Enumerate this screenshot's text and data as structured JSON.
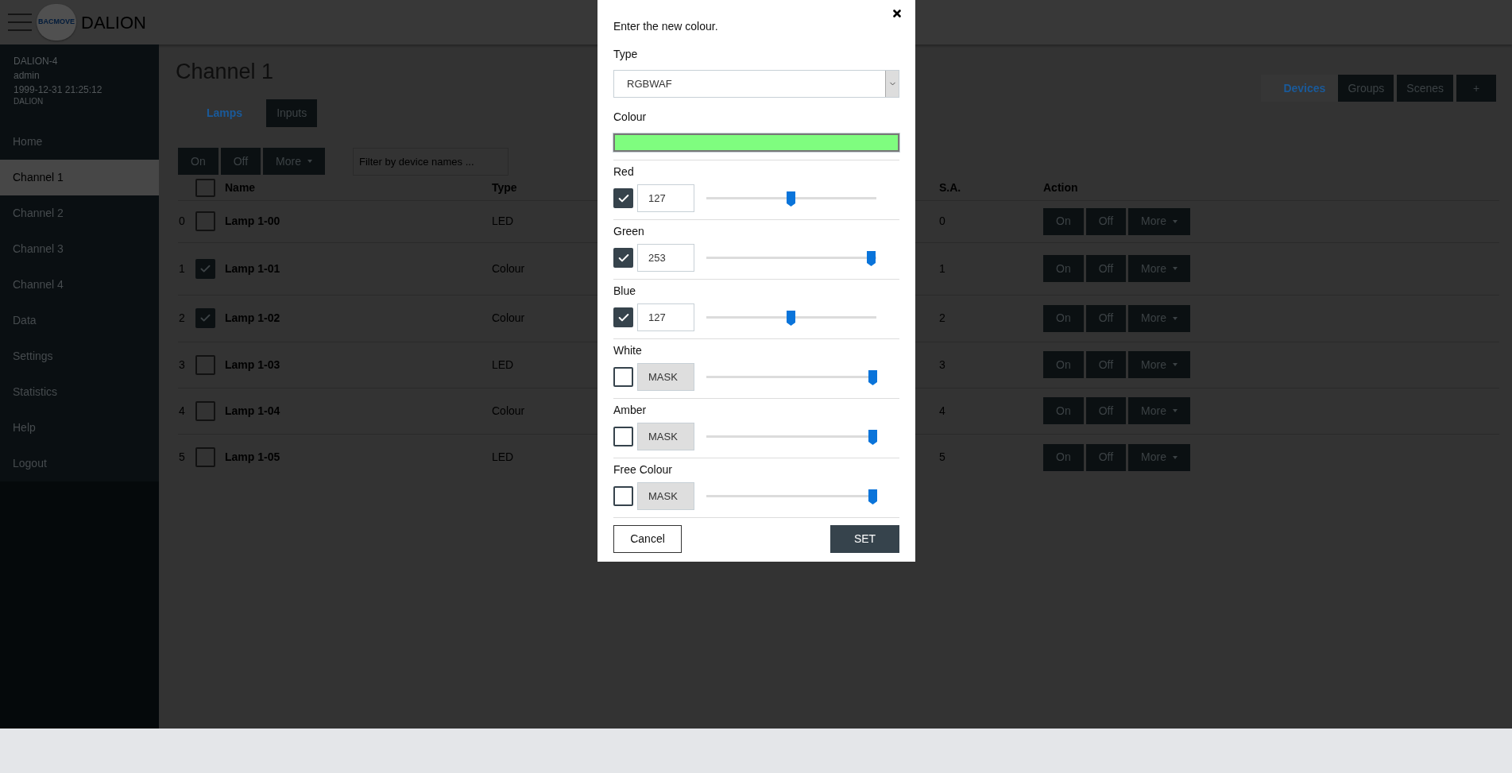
{
  "header": {
    "logo_text": "BACMOVE",
    "title": "DALION"
  },
  "sidebar": {
    "info": [
      "DALION-4",
      "admin",
      "1999-12-31 21:25:12",
      "DALION"
    ],
    "items": [
      {
        "label": "Home",
        "selected": false
      },
      {
        "label": "Channel 1",
        "selected": true
      },
      {
        "label": "Channel 2",
        "selected": false
      },
      {
        "label": "Channel 3",
        "selected": false
      },
      {
        "label": "Channel 4",
        "selected": false
      },
      {
        "label": "Data",
        "selected": false
      },
      {
        "label": "Settings",
        "selected": false
      },
      {
        "label": "Statistics",
        "selected": false
      },
      {
        "label": "Help",
        "selected": false
      },
      {
        "label": "Logout",
        "selected": false
      }
    ]
  },
  "page_title": "Channel 1",
  "view_tabs": [
    {
      "label": "Lamps",
      "selected": true
    },
    {
      "label": "Inputs",
      "selected": false
    }
  ],
  "top_tabs": [
    {
      "label": "Devices",
      "selected": true
    },
    {
      "label": "Groups",
      "selected": false
    },
    {
      "label": "Scenes",
      "selected": false
    },
    {
      "label": "+",
      "selected": false
    }
  ],
  "toolbar": {
    "buttons": [
      "On",
      "Off",
      "More"
    ],
    "filter_placeholder": "Filter by device names ..."
  },
  "table": {
    "columns": [
      "Name",
      "Type",
      "S.A.",
      "Action"
    ],
    "all_checked": false,
    "rows": [
      {
        "index": "0",
        "name": "Lamp 1-00",
        "type": "LED",
        "sa": "0",
        "checked": false,
        "actions": [
          "On",
          "Off",
          "More"
        ]
      },
      {
        "index": "1",
        "name": "Lamp 1-01",
        "type": "Colour",
        "sa": "1",
        "checked": true,
        "actions": [
          "On",
          "Off",
          "More"
        ]
      },
      {
        "index": "2",
        "name": "Lamp 1-02",
        "type": "Colour",
        "sa": "2",
        "checked": true,
        "actions": [
          "On",
          "Off",
          "More"
        ]
      },
      {
        "index": "3",
        "name": "Lamp 1-03",
        "type": "LED",
        "sa": "3",
        "checked": false,
        "actions": [
          "On",
          "Off",
          "More"
        ]
      },
      {
        "index": "4",
        "name": "Lamp 1-04",
        "type": "Colour",
        "sa": "4",
        "checked": false,
        "actions": [
          "On",
          "Off",
          "More"
        ]
      },
      {
        "index": "5",
        "name": "Lamp 1-05",
        "type": "LED",
        "sa": "5",
        "checked": false,
        "actions": [
          "On",
          "Off",
          "More"
        ]
      }
    ]
  },
  "dialog": {
    "message": "Enter the new colour.",
    "type_label": "Type",
    "type_value": "RGBWAF",
    "colour_label": "Colour",
    "channels": [
      {
        "label": "Red",
        "enabled": true,
        "value": "127",
        "level": 0.5
      },
      {
        "label": "Green",
        "enabled": true,
        "value": "253",
        "level": 0.97
      },
      {
        "label": "Blue",
        "enabled": true,
        "value": "127",
        "level": 0.5
      },
      {
        "label": "White",
        "enabled": false,
        "value": "MASK",
        "level": 0.98
      },
      {
        "label": "Amber",
        "enabled": false,
        "value": "MASK",
        "level": 0.98
      },
      {
        "label": "Free Colour",
        "enabled": false,
        "value": "MASK",
        "level": 0.98
      }
    ],
    "cancel": "Cancel",
    "set": "SET"
  }
}
